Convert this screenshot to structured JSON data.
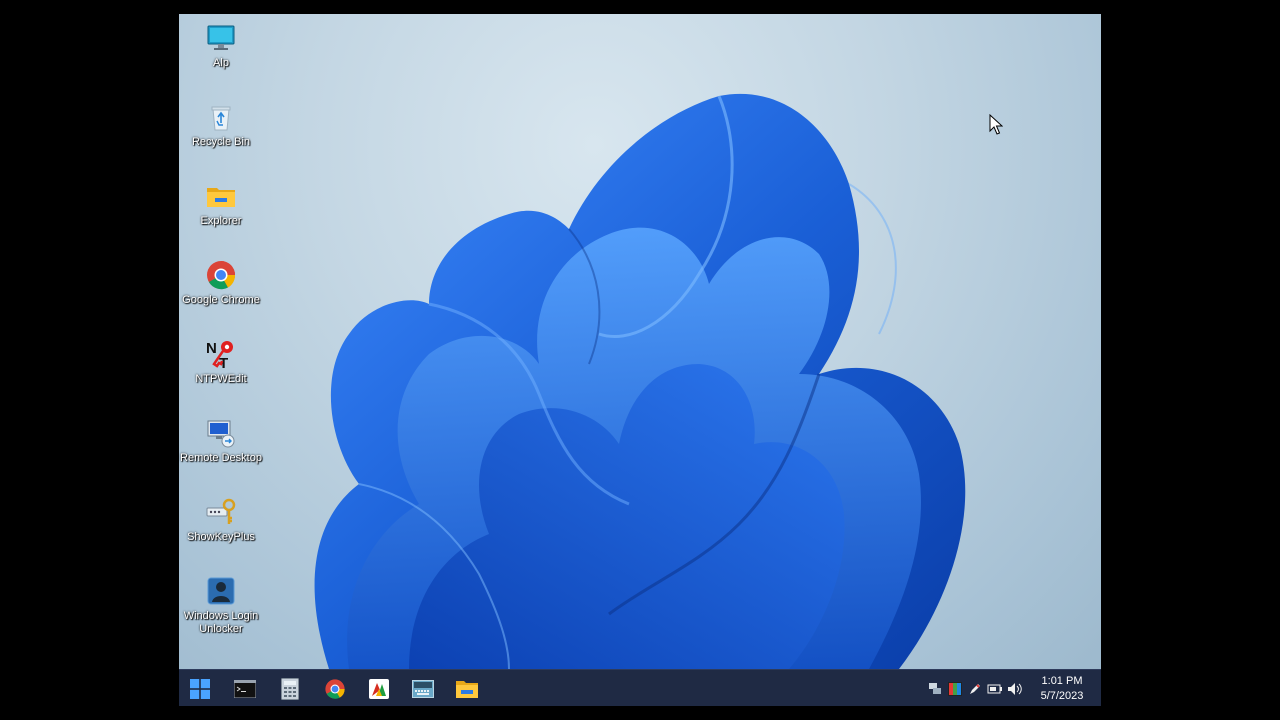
{
  "desktop": {
    "icons": [
      {
        "label": "Alp",
        "icon": "monitor-icon"
      },
      {
        "label": "Recycle Bin",
        "icon": "recycle-bin-icon"
      },
      {
        "label": "Explorer",
        "icon": "folder-icon"
      },
      {
        "label": "Google Chrome",
        "icon": "chrome-icon"
      },
      {
        "label": "NTPWEdit",
        "icon": "ntpwedit-icon"
      },
      {
        "label": "Remote Desktop",
        "icon": "remote-desktop-icon"
      },
      {
        "label": "ShowKeyPlus",
        "icon": "key-icon"
      },
      {
        "label": "Windows Login Unlocker",
        "icon": "login-unlocker-icon"
      }
    ]
  },
  "taskbar": {
    "color": "#1f2a44",
    "items": [
      {
        "icon": "start-icon"
      },
      {
        "icon": "terminal-icon"
      },
      {
        "icon": "calculator-icon"
      },
      {
        "icon": "chrome-icon"
      },
      {
        "icon": "app-icon"
      },
      {
        "icon": "keyboard-icon"
      },
      {
        "icon": "file-explorer-icon"
      }
    ]
  },
  "tray": {
    "icons": [
      "network-icon",
      "color-icon",
      "pen-icon",
      "battery-icon",
      "volume-icon"
    ],
    "time": "1:01 PM",
    "date": "5/7/2023"
  },
  "accent": "#1a5fd6"
}
